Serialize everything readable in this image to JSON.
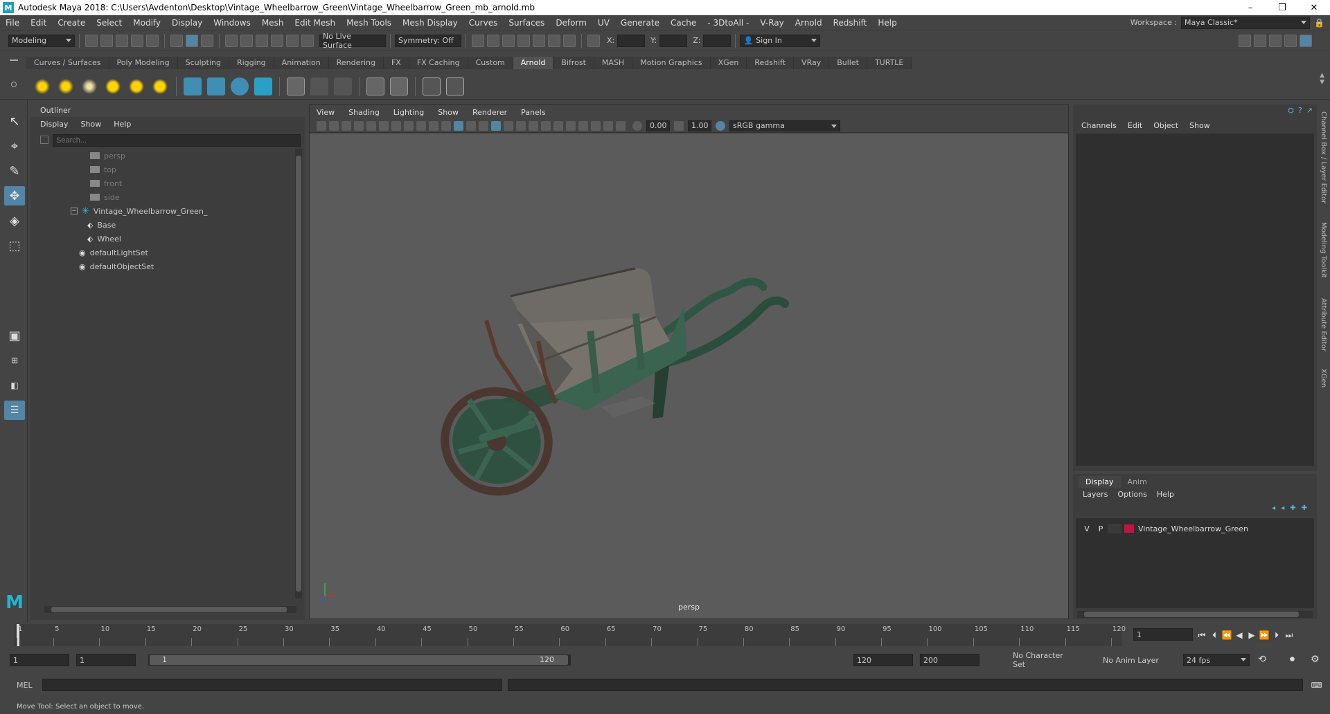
{
  "window": {
    "title": "Autodesk Maya 2018: C:\\Users\\Avdenton\\Desktop\\Vintage_Wheelbarrow_Green\\Vintage_Wheelbarrow_Green_mb_arnold.mb",
    "minimize": "–",
    "maximize": "❐",
    "close": "✕"
  },
  "menubar": {
    "items": [
      "File",
      "Edit",
      "Create",
      "Select",
      "Modify",
      "Display",
      "Windows",
      "Mesh",
      "Edit Mesh",
      "Mesh Tools",
      "Mesh Display",
      "Curves",
      "Surfaces",
      "Deform",
      "UV",
      "Generate",
      "Cache",
      "- 3DtoAll -",
      "V-Ray",
      "Arnold",
      "Redshift",
      "Help"
    ],
    "workspace_label": "Workspace :",
    "workspace_value": "Maya Classic*"
  },
  "statusline": {
    "mode": "Modeling",
    "live_surface": "No Live Surface",
    "symmetry": "Symmetry: Off",
    "x_label": "X:",
    "y_label": "Y:",
    "z_label": "Z:",
    "sign_in": "Sign In"
  },
  "shelf": {
    "tabs": [
      "Curves / Surfaces",
      "Poly Modeling",
      "Sculpting",
      "Rigging",
      "Animation",
      "Rendering",
      "FX",
      "FX Caching",
      "Custom",
      "Arnold",
      "Bifrost",
      "MASH",
      "Motion Graphics",
      "XGen",
      "Redshift",
      "VRay",
      "Bullet",
      "TURTLE"
    ],
    "active_tab": "Arnold"
  },
  "outliner": {
    "title": "Outliner",
    "menus": [
      "Display",
      "Show",
      "Help"
    ],
    "search_placeholder": "Search...",
    "items": [
      {
        "label": "persp",
        "dim": true
      },
      {
        "label": "top",
        "dim": true
      },
      {
        "label": "front",
        "dim": true
      },
      {
        "label": "side",
        "dim": true
      },
      {
        "label": "Vintage_Wheelbarrow_Green_",
        "dim": false
      },
      {
        "label": "Base",
        "dim": false
      },
      {
        "label": "Wheel",
        "dim": false
      },
      {
        "label": "defaultLightSet",
        "dim": false
      },
      {
        "label": "defaultObjectSet",
        "dim": false
      }
    ]
  },
  "viewport": {
    "menus": [
      "View",
      "Shading",
      "Lighting",
      "Show",
      "Renderer",
      "Panels"
    ],
    "exposure": "0.00",
    "gamma": "1.00",
    "color_space": "sRGB gamma",
    "camera_label": "persp"
  },
  "channelbox": {
    "menus": [
      "Channels",
      "Edit",
      "Object",
      "Show"
    ]
  },
  "layereditor": {
    "tabs": [
      "Display",
      "Anim"
    ],
    "active_tab": "Display",
    "menus": [
      "Layers",
      "Options",
      "Help"
    ],
    "layer": {
      "v": "V",
      "p": "P",
      "name": "Vintage_Wheelbarrow_Green",
      "color": "#c0163e"
    }
  },
  "sidetabs": [
    "Channel Box / Layer Editor",
    "Modeling Toolkit",
    "Attribute Editor",
    "XGen"
  ],
  "timeslider": {
    "ticks": [
      "1",
      "5",
      "10",
      "15",
      "20",
      "25",
      "30",
      "35",
      "40",
      "45",
      "50",
      "55",
      "60",
      "65",
      "70",
      "75",
      "80",
      "85",
      "90",
      "95",
      "100",
      "105",
      "110",
      "115",
      "120"
    ],
    "current_frame": "1"
  },
  "rangeslider": {
    "start": "1",
    "range_start": "1",
    "range_start_inner": "1",
    "range_end_inner": "120",
    "range_end": "120",
    "end": "200",
    "character_set": "No Character Set",
    "anim_layer": "No Anim Layer",
    "fps": "24 fps"
  },
  "cmdline": {
    "label": "MEL"
  },
  "helpline": {
    "text": "Move Tool: Select an object to move."
  },
  "colors": {
    "accent": "#5285a6",
    "wheelbarrow_green": "#3f6b54",
    "layer_red": "#c0163e"
  }
}
